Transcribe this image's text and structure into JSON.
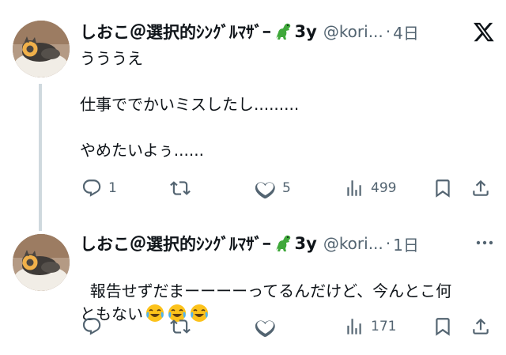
{
  "posts": [
    {
      "author": {
        "display_name": "しおこ＠選択的ｼﾝｸﾞﾙﾏｻﾞｰ",
        "name_suffix": "3y",
        "handle": "@kori...",
        "time": "4日"
      },
      "text": "うううえ\n\n仕事ででかいミスしたし.........\n\nやめたいよぅ......",
      "stats": {
        "replies": "1",
        "retweets": "",
        "likes": "5",
        "views": "499"
      },
      "header_icon": "x-logo-icon"
    },
    {
      "author": {
        "display_name": "しおこ＠選択的ｼﾝｸﾞﾙﾏｻﾞｰ",
        "name_suffix": "3y",
        "handle": "@kori...",
        "time": "1日"
      },
      "text": "報告せずだまーーーーってるんだけど、今んとこ何\nともない",
      "emojis": [
        "tears-of-joy-emoji",
        "tears-of-joy-emoji",
        "tears-of-joy-emoji"
      ],
      "stats": {
        "replies": "",
        "retweets": "",
        "likes": "",
        "views": "171"
      },
      "header_icon": "more-options-icon"
    }
  ],
  "colors": {
    "text": "#0f1419",
    "secondary": "#536471",
    "thread_line": "#cfd9de"
  }
}
